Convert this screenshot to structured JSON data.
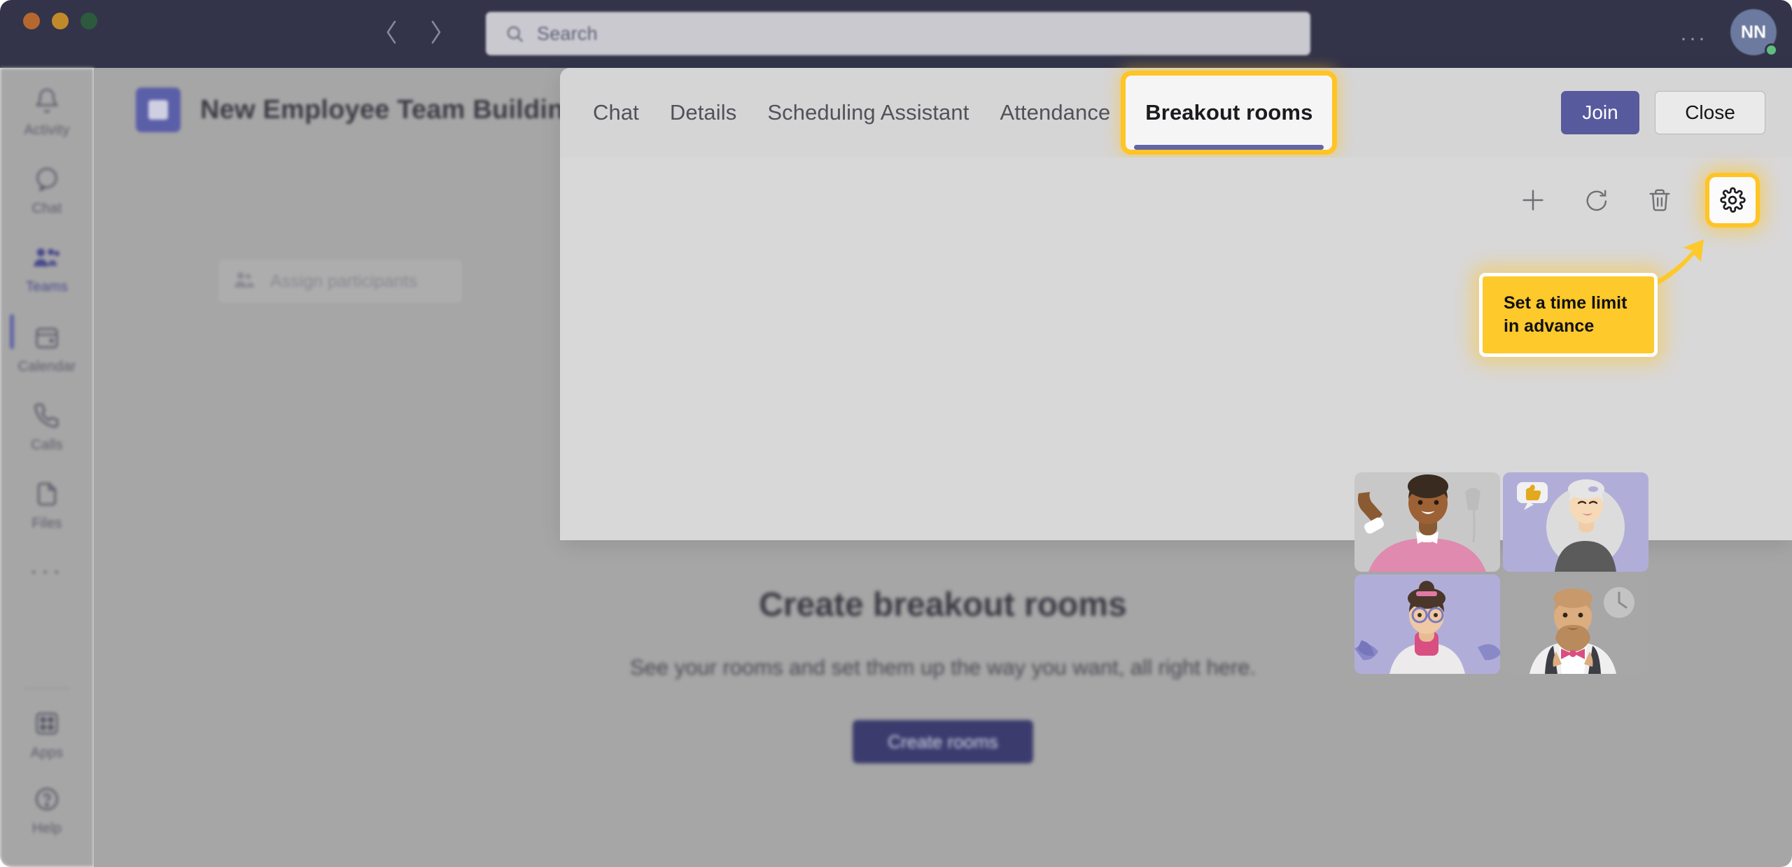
{
  "window": {
    "traffic_lights": [
      "close",
      "minimize",
      "maximize"
    ],
    "more_options": "···",
    "avatar_initials": "NN"
  },
  "search": {
    "placeholder": "Search",
    "value": "Search",
    "icon": "search-icon"
  },
  "nav": {
    "back_icon": "chevron-left-icon",
    "forward_icon": "chevron-right-icon"
  },
  "rail": {
    "items": [
      {
        "label": "Activity",
        "icon": "bell-icon",
        "active": false
      },
      {
        "label": "Chat",
        "icon": "chat-bubble-icon",
        "active": false
      },
      {
        "label": "Teams",
        "icon": "people-icon",
        "active": true
      },
      {
        "label": "Calendar",
        "icon": "calendar-icon",
        "active": false
      },
      {
        "label": "Calls",
        "icon": "phone-icon",
        "active": false
      },
      {
        "label": "Files",
        "icon": "file-icon",
        "active": false
      },
      {
        "label": "···",
        "icon": "more-icon",
        "active": false
      },
      {
        "label": "Apps",
        "icon": "apps-grid-icon",
        "active": false
      },
      {
        "label": "Help",
        "icon": "help-circle-icon",
        "active": false
      }
    ]
  },
  "meeting": {
    "title": "New Employee Team Building",
    "icon": "calendar-event-icon",
    "assign_participants_label": "Assign participants",
    "assign_participants_icon": "people-assign-icon"
  },
  "modal": {
    "tabs": [
      {
        "label": "Chat",
        "active": false
      },
      {
        "label": "Details",
        "active": false
      },
      {
        "label": "Scheduling Assistant",
        "active": false
      },
      {
        "label": "Attendance",
        "active": false
      },
      {
        "label": "Breakout rooms",
        "active": true
      }
    ],
    "join_label": "Join",
    "close_label": "Close",
    "toolbar": [
      {
        "name": "add-room-button",
        "icon": "plus-icon"
      },
      {
        "name": "recreate-rooms-button",
        "icon": "refresh-icon"
      },
      {
        "name": "delete-rooms-button",
        "icon": "trash-icon"
      },
      {
        "name": "rooms-settings-button",
        "icon": "gear-icon",
        "highlighted": true
      }
    ]
  },
  "empty_state": {
    "title": "Create breakout rooms",
    "subtitle": "See your rooms and set them up the way you want, all right here.",
    "button_label": "Create rooms",
    "illustration": "video-call-grid-illustration"
  },
  "callout": {
    "line1": "Set a time limit",
    "line2": "in advance",
    "arrow_icon": "callout-arrow-icon"
  },
  "colors": {
    "titlebar": "#33344a",
    "accent_purple": "#6264a7",
    "join_button": "#585a9e",
    "highlight_yellow": "#ffc425",
    "callout_bg": "#fdc92b",
    "rail_bg": "#a6a6a6",
    "modal_bg": "#d6d5d5"
  }
}
